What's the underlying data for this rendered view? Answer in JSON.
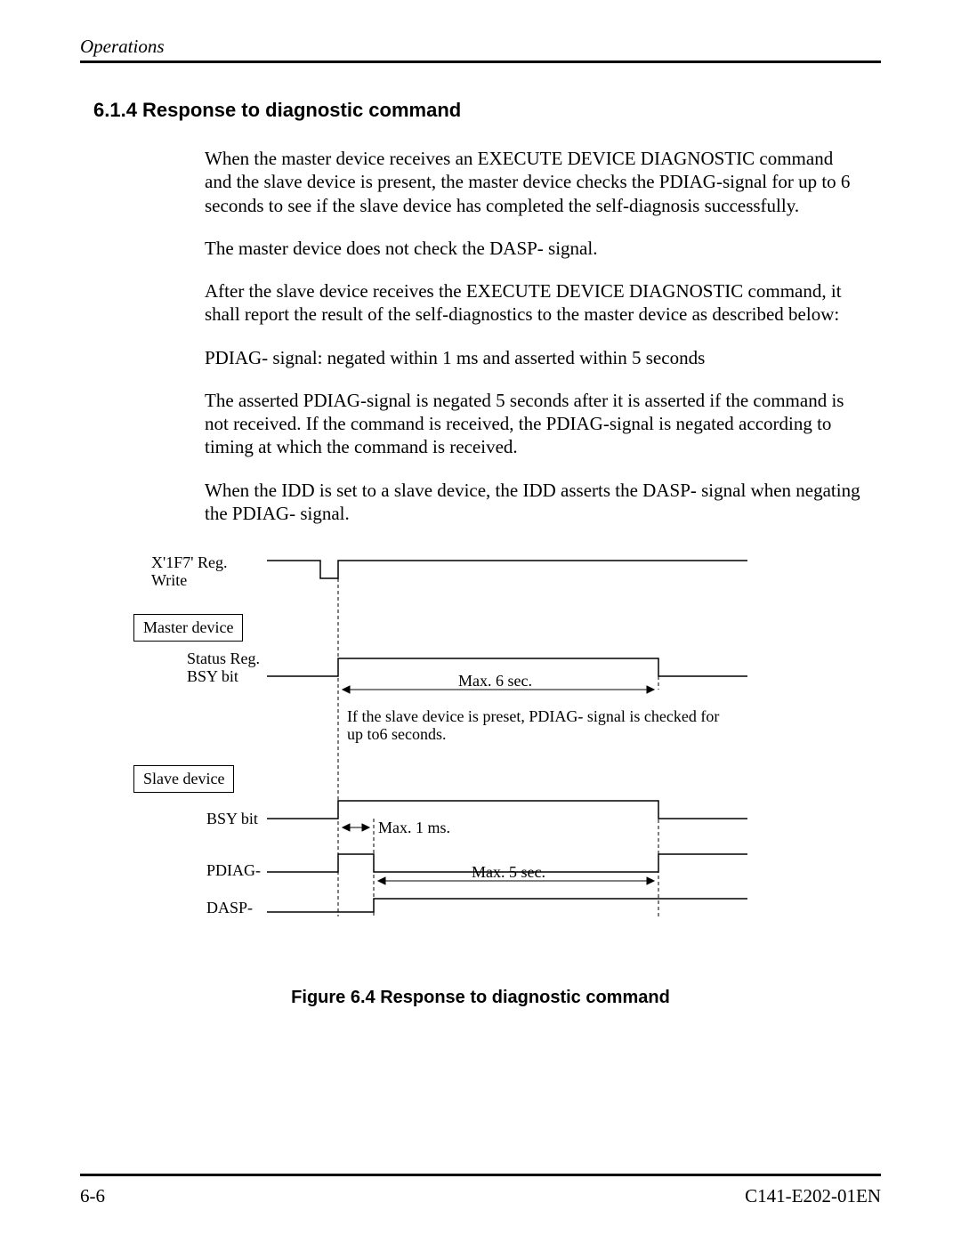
{
  "header": {
    "section": "Operations"
  },
  "heading": "6.1.4  Response to diagnostic command",
  "paragraphs": {
    "p1": "When the master device receives an EXECUTE DEVICE DIAGNOSTIC command and the slave device is present, the master device checks the PDIAG-signal for up to 6 seconds to see if the slave device has completed the self-diagnosis successfully.",
    "p2": "The master device does not check the DASP- signal.",
    "p3": "After the slave device receives the EXECUTE DEVICE DIAGNOSTIC command, it shall report the result of the self-diagnostics to the master device as described below:",
    "p4": "PDIAG- signal:  negated within 1 ms and asserted within 5 seconds",
    "p5": "The asserted PDIAG-signal is negated 5 seconds after it is asserted if the command is not received. If the command is received, the PDIAG-signal is negated according to timing at which the command is received.",
    "p6": "When the IDD is set to a slave device, the IDD asserts the DASP- signal when negating the PDIAG- signal."
  },
  "diagram": {
    "reg_write": "X'1F7' Reg.",
    "write": "Write",
    "master_device": "Master device",
    "status_reg": "Status Reg.",
    "bsy_bit": "BSY bit",
    "max6": "Max. 6 sec.",
    "note1": "If the slave device is preset, PDIAG- signal is checked for",
    "note2": "up to6 seconds.",
    "slave_device": "Slave device",
    "bsy_bit2": "BSY bit",
    "max1ms": "Max. 1 ms.",
    "pdiag": "PDIAG-",
    "max5": "Max. 5 sec.",
    "dasp": "DASP-"
  },
  "figure_caption": "Figure 6.4  Response to diagnostic command",
  "footer": {
    "page": "6-6",
    "docid": "C141-E202-01EN"
  }
}
